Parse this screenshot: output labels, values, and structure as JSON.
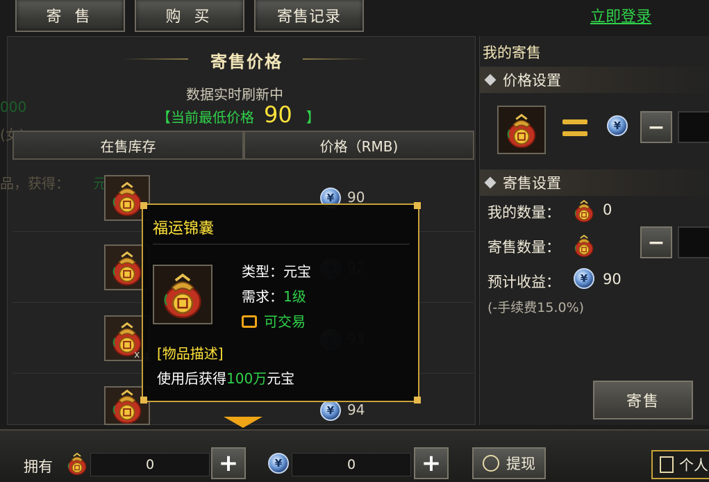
{
  "tabs": [
    {
      "label": "寄 售"
    },
    {
      "label": "购 买"
    },
    {
      "label": "寄售记录"
    }
  ],
  "login_link": "立即登录",
  "background_ghost": {
    "line1": "000",
    "line2": "(女)",
    "line3": "品，获得：",
    "line3_green": "元宝"
  },
  "market": {
    "title": "寄售价格",
    "refresh_text": "数据实时刷新中",
    "lowest_prefix": "【当前最低价格",
    "lowest_value": "90",
    "lowest_suffix": "】",
    "col_stock": "在售库存",
    "col_price": "价格（RMB)",
    "listings": [
      {
        "price": "90"
      },
      {
        "price": "92"
      },
      {
        "price": "93"
      },
      {
        "price": "94"
      }
    ],
    "partial_marks": [
      "x",
      "4"
    ]
  },
  "tooltip": {
    "name": "福运锦囊",
    "type_label": "类型：",
    "type_value": "元宝",
    "req_label": "需求：",
    "req_value": "1级",
    "tradable": "可交易",
    "desc_title": "[物品描述]",
    "desc_prefix": "使用后获得",
    "desc_amount": "100万",
    "desc_suffix": "元宝"
  },
  "my_sale": {
    "title": "我的寄售",
    "price_section": "价格设置",
    "sale_section": "寄售设置",
    "my_qty_label": "我的数量：",
    "my_qty_value": "0",
    "sale_qty_label": "寄售数量：",
    "est_income_label": "预计收益：",
    "est_income_value": "90",
    "fee_note": "(-手续费15.0%)",
    "minus": "−",
    "sell_button": "寄售"
  },
  "bottom": {
    "own_label": "拥有",
    "item_count": "0",
    "coin_count": "0",
    "plus": "+",
    "withdraw": "提现",
    "personal": "个人"
  },
  "colors": {
    "accent_gold": "#c8a23a",
    "green": "#2fd24a",
    "yellow": "#ffe23a"
  }
}
